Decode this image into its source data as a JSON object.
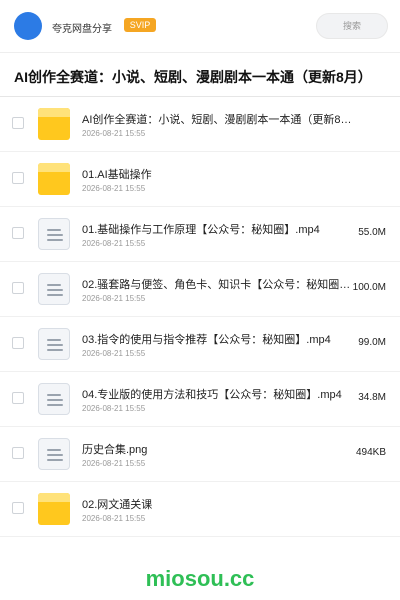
{
  "header": {
    "username": "夸克网盘分享",
    "badge": "SVIP",
    "search_placeholder": "搜索"
  },
  "title": "AI创作全赛道：小说、短剧、漫剧剧本一本通（更新8月）",
  "items": [
    {
      "type": "folder",
      "name": "AI创作全赛道：小说、短剧、漫剧剧本一本通（更新8月）",
      "date": "2026-08-21 15:55",
      "size": ""
    },
    {
      "type": "folder",
      "name": "01.AI基础操作",
      "date": "2026-08-21 15:55",
      "size": ""
    },
    {
      "type": "file",
      "name": "01.基础操作与工作原理【公众号：秘知圈】.mp4",
      "date": "2026-08-21 15:55",
      "size": "55.0M"
    },
    {
      "type": "file",
      "name": "02.骚套路与便签、角色卡、知识卡【公众号：秘知圈】.mp4",
      "date": "2026-08-21 15:55",
      "size": "100.0M"
    },
    {
      "type": "file",
      "name": "03.指令的使用与指令推荐【公众号：秘知圈】.mp4",
      "date": "2026-08-21 15:55",
      "size": "99.0M"
    },
    {
      "type": "file",
      "name": "04.专业版的使用方法和技巧【公众号：秘知圈】.mp4",
      "date": "2026-08-21 15:55",
      "size": "34.8M"
    },
    {
      "type": "file",
      "name": "历史合集.png",
      "date": "2026-08-21 15:55",
      "size": "494KB"
    },
    {
      "type": "folder",
      "name": "02.网文通关课",
      "date": "2026-08-21 15:55",
      "size": ""
    }
  ],
  "watermark": "miosou.cc"
}
